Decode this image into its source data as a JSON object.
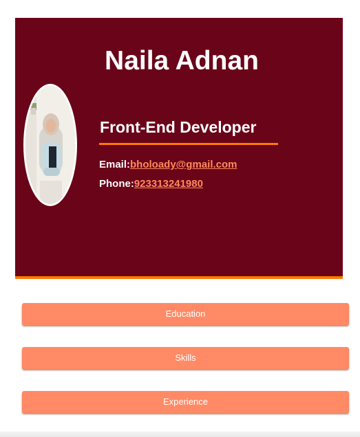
{
  "profile": {
    "name": "Naila Adnan",
    "role": "Front-End Developer",
    "email_label": "Email:",
    "email": "bholoady@gmail.com",
    "phone_label": "Phone:",
    "phone": "923313241980",
    "photo_icon": "profile-photo"
  },
  "sections": {
    "education": "Education",
    "skills": "Skills",
    "experience": "Experience"
  },
  "colors": {
    "header_background": "#6a0419",
    "accent": "#ff7a00",
    "link": "#ff8a5c",
    "button": "#ff8a65"
  }
}
